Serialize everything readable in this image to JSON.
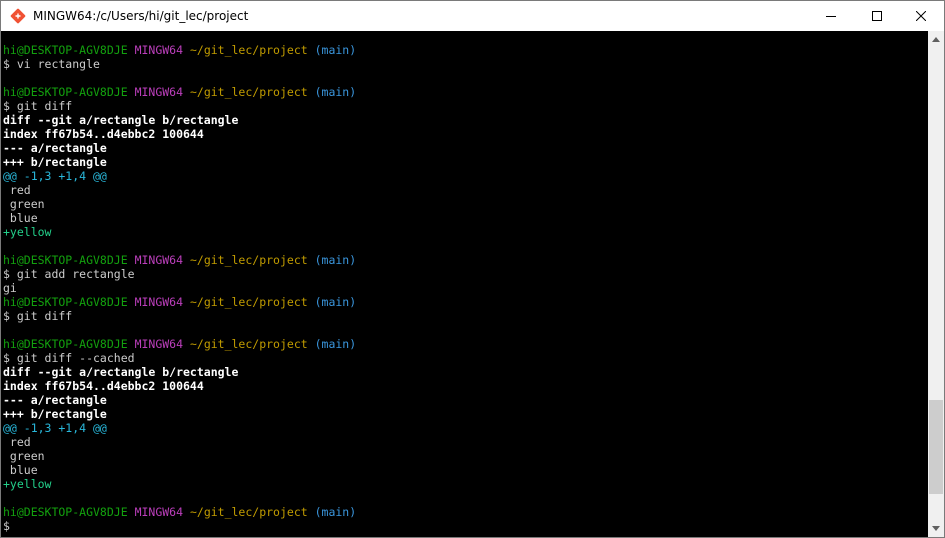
{
  "window": {
    "title": "MINGW64:/c/Users/hi/git_lec/project",
    "icons": {
      "app": "git-bash-icon",
      "minimize": "minimize-icon",
      "maximize": "maximize-icon",
      "close": "close-icon"
    }
  },
  "colors": {
    "user": "#13a10e",
    "msys": "#bc3fbc",
    "path": "#c19c00",
    "branch": "#3a96dd",
    "added": "#23d18b",
    "hunk": "#29b8db",
    "background": "#000000"
  },
  "terminal": {
    "lines": [
      {
        "type": "prompt",
        "user": "hi@DESKTOP-AGV8DJE",
        "msys": "MINGW64",
        "path": "~/git_lec/project",
        "branch": "(main)"
      },
      {
        "type": "plain",
        "text": "$ vi rectangle"
      },
      {
        "type": "blank",
        "text": ""
      },
      {
        "type": "prompt",
        "user": "hi@DESKTOP-AGV8DJE",
        "msys": "MINGW64",
        "path": "~/git_lec/project",
        "branch": "(main)"
      },
      {
        "type": "plain",
        "text": "$ git diff"
      },
      {
        "type": "bold",
        "text": "diff --git a/rectangle b/rectangle"
      },
      {
        "type": "bold",
        "text": "index ff67b54..d4ebbc2 100644"
      },
      {
        "type": "bold",
        "text": "--- a/rectangle"
      },
      {
        "type": "bold",
        "text": "+++ b/rectangle"
      },
      {
        "type": "hunk",
        "text": "@@ -1,3 +1,4 @@"
      },
      {
        "type": "plain",
        "text": " red"
      },
      {
        "type": "plain",
        "text": " green"
      },
      {
        "type": "plain",
        "text": " blue"
      },
      {
        "type": "added",
        "text": "+yellow"
      },
      {
        "type": "blank",
        "text": ""
      },
      {
        "type": "prompt",
        "user": "hi@DESKTOP-AGV8DJE",
        "msys": "MINGW64",
        "path": "~/git_lec/project",
        "branch": "(main)"
      },
      {
        "type": "plain",
        "text": "$ git add rectangle"
      },
      {
        "type": "plain",
        "text": "gi"
      },
      {
        "type": "prompt",
        "user": "hi@DESKTOP-AGV8DJE",
        "msys": "MINGW64",
        "path": "~/git_lec/project",
        "branch": "(main)"
      },
      {
        "type": "plain",
        "text": "$ git diff"
      },
      {
        "type": "blank",
        "text": ""
      },
      {
        "type": "prompt",
        "user": "hi@DESKTOP-AGV8DJE",
        "msys": "MINGW64",
        "path": "~/git_lec/project",
        "branch": "(main)"
      },
      {
        "type": "plain",
        "text": "$ git diff --cached"
      },
      {
        "type": "bold",
        "text": "diff --git a/rectangle b/rectangle"
      },
      {
        "type": "bold",
        "text": "index ff67b54..d4ebbc2 100644"
      },
      {
        "type": "bold",
        "text": "--- a/rectangle"
      },
      {
        "type": "bold",
        "text": "+++ b/rectangle"
      },
      {
        "type": "hunk",
        "text": "@@ -1,3 +1,4 @@"
      },
      {
        "type": "plain",
        "text": " red"
      },
      {
        "type": "plain",
        "text": " green"
      },
      {
        "type": "plain",
        "text": " blue"
      },
      {
        "type": "added",
        "text": "+yellow"
      },
      {
        "type": "blank",
        "text": ""
      },
      {
        "type": "prompt",
        "user": "hi@DESKTOP-AGV8DJE",
        "msys": "MINGW64",
        "path": "~/git_lec/project",
        "branch": "(main)"
      },
      {
        "type": "plain",
        "text": "$"
      }
    ]
  },
  "scrollbar": {
    "icons": {
      "up": "chevron-up-icon",
      "down": "chevron-down-icon"
    },
    "position": 0.93,
    "visible_fraction": 0.2
  }
}
